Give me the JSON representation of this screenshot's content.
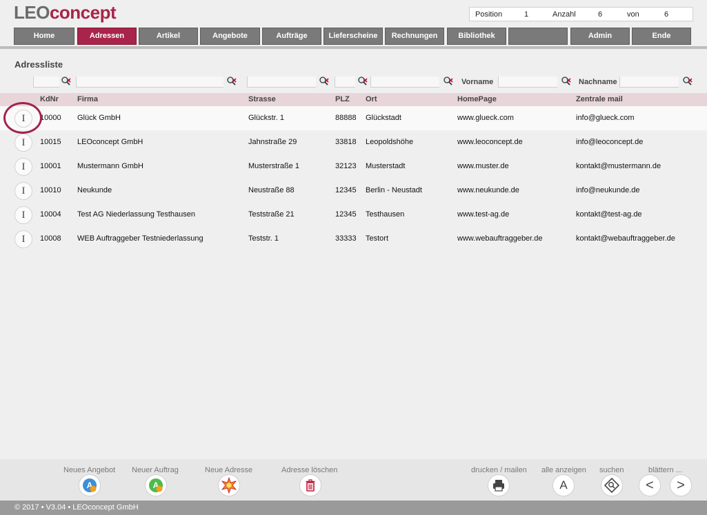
{
  "app": {
    "logo_leo": "LEO",
    "logo_concept": "concept",
    "brand_color": "#a8244a"
  },
  "info": {
    "position_label": "Position",
    "position_value": "1",
    "anzahl_label": "Anzahl",
    "anzahl_value": "6",
    "von_label": "von",
    "von_value": "6"
  },
  "nav": {
    "items": [
      {
        "label": "Home"
      },
      {
        "label": "Adressen",
        "active": true
      },
      {
        "label": "Artikel"
      },
      {
        "label": "Angebote"
      },
      {
        "label": "Aufträge"
      },
      {
        "label": "Lieferscheine"
      },
      {
        "label": "Rechnungen"
      },
      {
        "label": "Bibliothek"
      },
      {
        "label": ""
      },
      {
        "label": "Admin"
      },
      {
        "label": "Ende"
      }
    ]
  },
  "page": {
    "title": "Adressliste"
  },
  "filters": {
    "vorname_label": "Vorname",
    "nachname_label": "Nachname",
    "icon": "search-clear-icon"
  },
  "table": {
    "columns": [
      "KdNr",
      "Firma",
      "Strasse",
      "PLZ",
      "Ort",
      "HomePage",
      "Zentrale mail"
    ],
    "row_button_glyph": "I",
    "rows": [
      {
        "kdnr": "10000",
        "firma": "Glück GmbH",
        "strasse": "Glückstr. 1",
        "plz": "88888",
        "ort": "Glückstadt",
        "homepage": "www.glueck.com",
        "mail": "info@glueck.com"
      },
      {
        "kdnr": "10015",
        "firma": "LEOconcept GmbH",
        "strasse": "Jahnstraße 29",
        "plz": "33818",
        "ort": "Leopoldshöhe",
        "homepage": "www.leoconcept.de",
        "mail": "info@leoconcept.de"
      },
      {
        "kdnr": "10001",
        "firma": "Mustermann GmbH",
        "strasse": "Musterstraße 1",
        "plz": "32123",
        "ort": "Musterstadt",
        "homepage": "www.muster.de",
        "mail": "kontakt@mustermann.de"
      },
      {
        "kdnr": "10010",
        "firma": "Neukunde",
        "strasse": "Neustraße 88",
        "plz": "12345",
        "ort": "Berlin - Neustadt",
        "homepage": "www.neukunde.de",
        "mail": "info@neukunde.de"
      },
      {
        "kdnr": "10004",
        "firma": "Test AG Niederlassung Testhausen",
        "strasse": "Teststraße 21",
        "plz": "12345",
        "ort": "Testhausen",
        "homepage": "www.test-ag.de",
        "mail": "kontakt@test-ag.de"
      },
      {
        "kdnr": "10008",
        "firma": "WEB Auftraggeber Testniederlassung",
        "strasse": "Teststr. 1",
        "plz": "33333",
        "ort": "Testort",
        "homepage": "www.webauftraggeber.de",
        "mail": "kontakt@webauftraggeber.de"
      }
    ]
  },
  "actions": {
    "neues_angebot": "Neues Angebot",
    "neuer_auftrag": "Neuer Auftrag",
    "neue_adresse": "Neue Adresse",
    "adresse_loeschen": "Adresse löschen",
    "drucken": "drucken / mailen",
    "alle_anzeigen": "alle anzeigen",
    "alle_anzeigen_glyph": "A",
    "suchen": "suchen",
    "blaettern": "blättern ...",
    "prev_glyph": "<",
    "next_glyph": ">"
  },
  "footer": {
    "text": "© 2017 • V3.04 • LEOconcept GmbH"
  }
}
